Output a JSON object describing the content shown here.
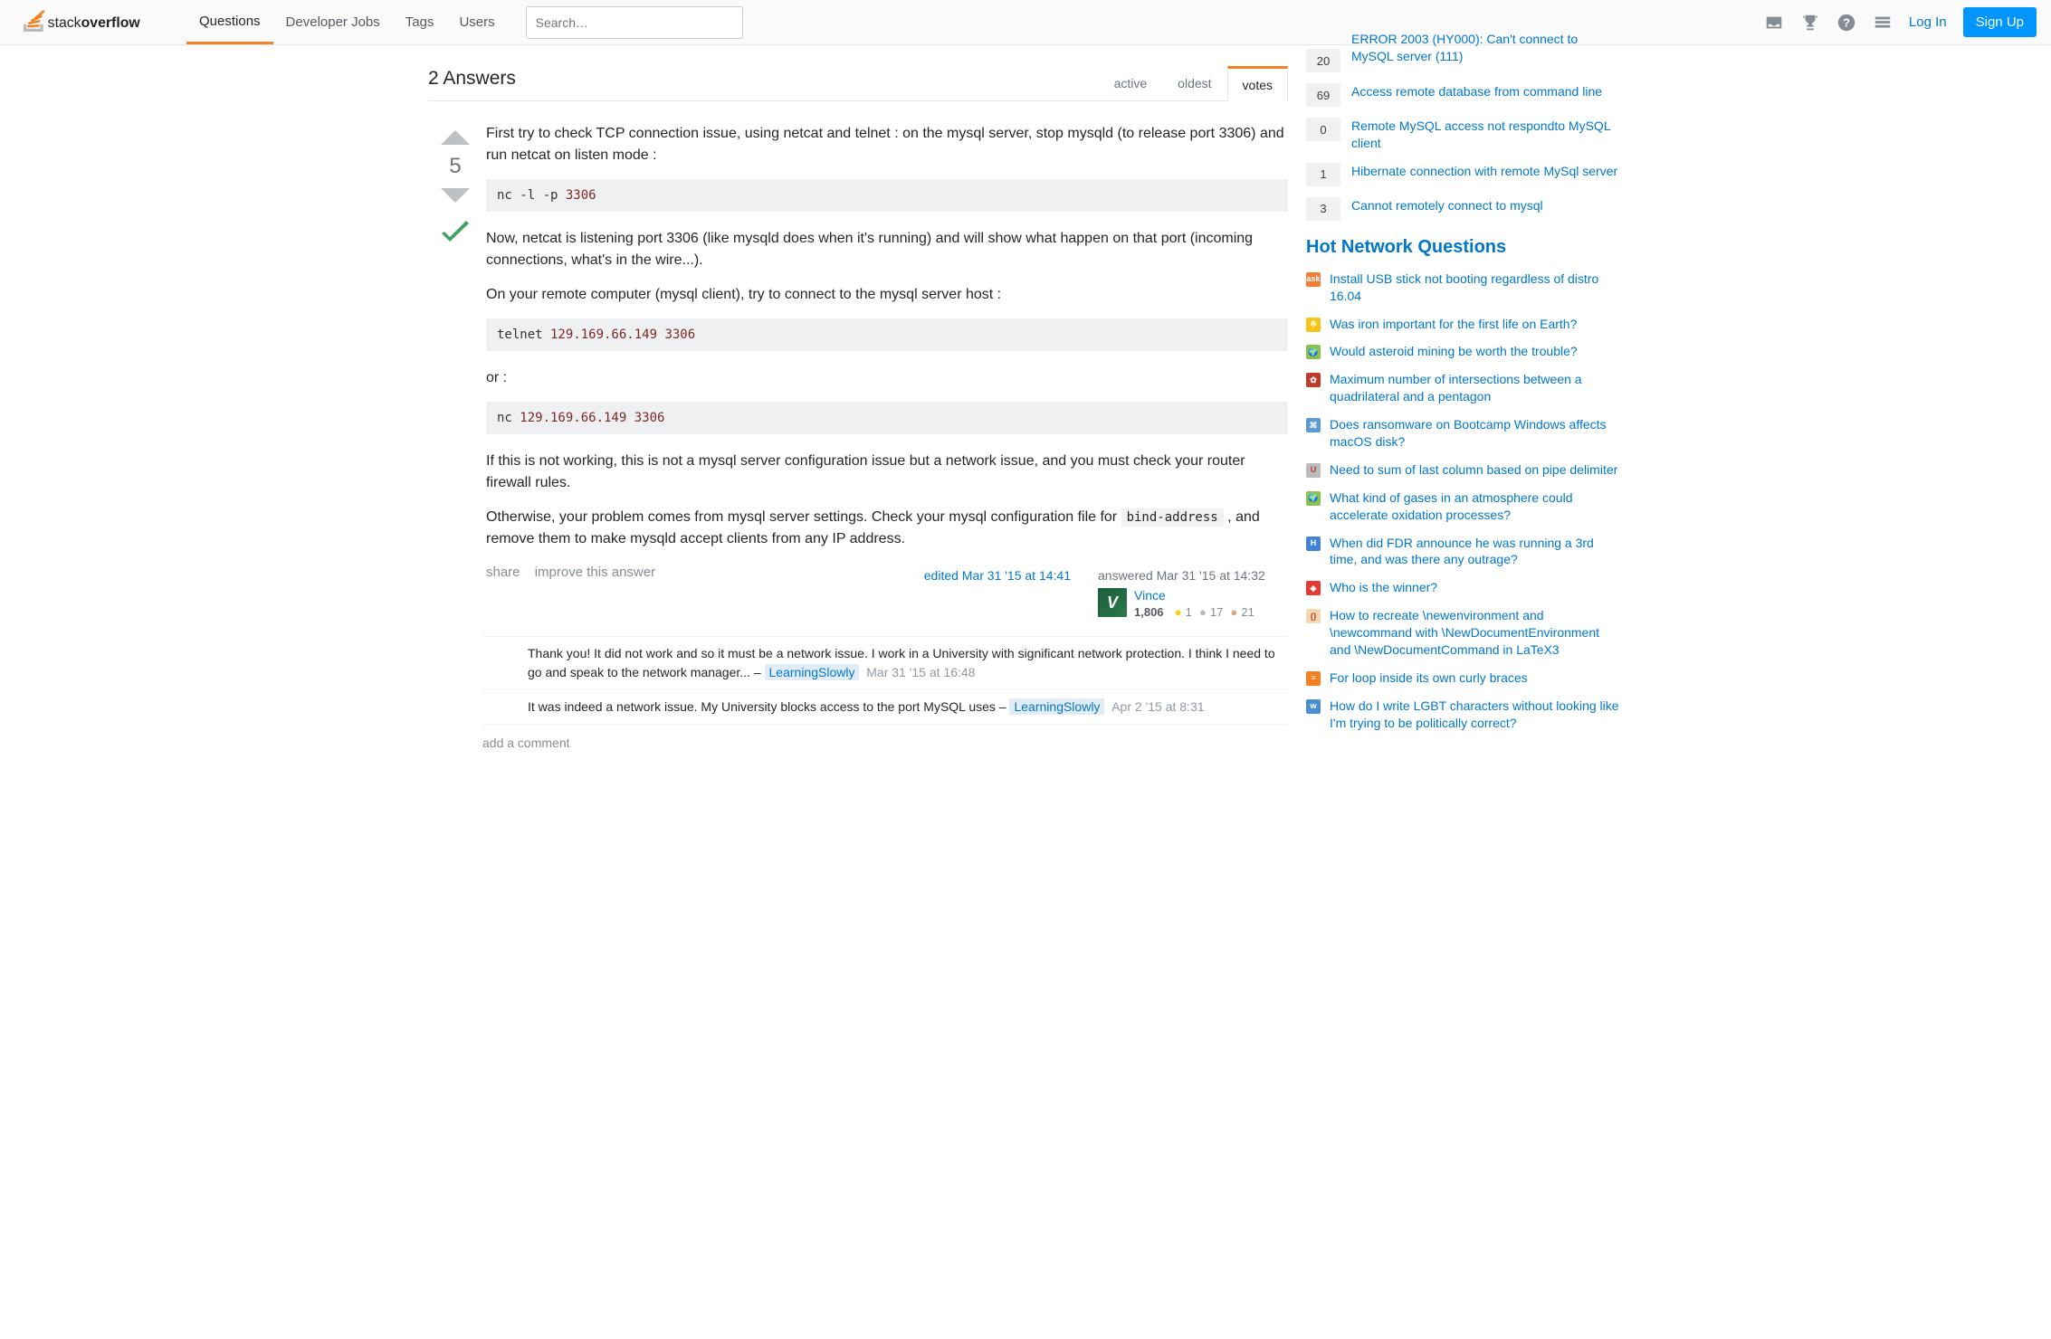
{
  "nav": {
    "questions": "Questions",
    "jobs": "Developer Jobs",
    "tags": "Tags",
    "users": "Users"
  },
  "search": {
    "placeholder": "Search…"
  },
  "auth": {
    "login": "Log In",
    "signup": "Sign Up"
  },
  "answers_header": "2 Answers",
  "tabs": {
    "active": "active",
    "oldest": "oldest",
    "votes": "votes"
  },
  "answer": {
    "votes": "5",
    "p1": "First try to check TCP connection issue, using netcat and telnet : on the mysql server, stop mysqld (to release port 3306) and run netcat on listen mode :",
    "code1": {
      "cmd": "nc",
      "args": " -l -p ",
      "num": "3306"
    },
    "p2": "Now, netcat is listening port 3306 (like mysqld does when it's running) and will show what happen on that port (incoming connections, what's in the wire...).",
    "p3": "On your remote computer (mysql client), try to connect to the mysql server host :",
    "code2": {
      "cmd": "telnet",
      "ip": " 129.169.66.149 ",
      "port": "3306"
    },
    "p4": "or :",
    "code3": {
      "cmd": "nc",
      "ip": " 129.169.66.149 ",
      "port": "3306"
    },
    "p5": "If this is not working, this is not a mysql server configuration issue but a network issue, and you must check your router firewall rules.",
    "p6a": "Otherwise, your problem comes from mysql server settings. Check your mysql configuration file for ",
    "p6code": "bind-address",
    "p6b": " , and remove them to make mysqld accept clients from any IP address.",
    "menu": {
      "share": "share",
      "improve": "improve this answer"
    },
    "edited": "edited Mar 31 '15 at 14:41",
    "answered": "answered Mar 31 '15 at 14:32",
    "user": {
      "name": "Vince",
      "rep": "1,806",
      "gold": "1",
      "silver": "17",
      "bronze": "21"
    }
  },
  "comments": [
    {
      "text": "Thank you! It did not work and so it must be a network issue. I work in a University with significant network protection. I think I need to go and speak to the network manager... – ",
      "user": "LearningSlowly",
      "date": "Mar 31 '15 at 16:48"
    },
    {
      "text": "It was indeed a network issue. My University blocks access to the port MySQL uses – ",
      "user": "LearningSlowly",
      "date": "Apr 2 '15 at 8:31"
    }
  ],
  "add_comment": "add a comment",
  "related": [
    {
      "score": "20",
      "title": "ERROR 2003 (HY000): Can't connect to MySQL server (111)"
    },
    {
      "score": "69",
      "title": "Access remote database from command line"
    },
    {
      "score": "0",
      "title": "Remote MySQL access not respondto MySQL client"
    },
    {
      "score": "1",
      "title": "Hibernate connection with remote MySql server"
    },
    {
      "score": "3",
      "title": "Cannot remotely connect to mysql"
    }
  ],
  "hnq_header": "Hot Network Questions",
  "hnq": [
    {
      "icon_bg": "#f27b35",
      "icon_text": "ask",
      "title": "Install USB stick not booting regardless of distro 16.04"
    },
    {
      "icon_bg": "#f5c518",
      "icon_text": "※",
      "title": "Was iron important for the first life on Earth?"
    },
    {
      "icon_bg": "#8bc34a",
      "icon_text": "🌍",
      "title": "Would asteroid mining be worth the trouble?"
    },
    {
      "icon_bg": "#c0392b",
      "icon_text": "✿",
      "title": "Maximum number of intersections between a quadrilateral and a pentagon"
    },
    {
      "icon_bg": "#5a9bd5",
      "icon_text": "⌘",
      "title": "Does ransomware on Bootcamp Windows affects macOS disk?"
    },
    {
      "icon_bg": "#bbb",
      "icon_text": "U",
      "title": "Need to sum of last column based on pipe delimiter"
    },
    {
      "icon_bg": "#8bc34a",
      "icon_text": "🌍",
      "title": "What kind of gases in an atmosphere could accelerate oxidation processes?"
    },
    {
      "icon_bg": "#4183d7",
      "icon_text": "H",
      "title": "When did FDR announce he was running a 3rd time, and was there any outrage?"
    },
    {
      "icon_bg": "#e53935",
      "icon_text": "◈",
      "title": "Who is the winner?"
    },
    {
      "icon_bg": "#f5d7b0",
      "icon_text": "{}",
      "title": "How to recreate \\newenvironment and \\newcommand with \\NewDocumentEnvironment and \\NewDocumentCommand in LaTeX3"
    },
    {
      "icon_bg": "#f48024",
      "icon_text": "≡",
      "title": "For loop inside its own curly braces"
    },
    {
      "icon_bg": "#4a8ed6",
      "icon_text": "w",
      "title": "How do I write LGBT characters without looking like I'm trying to be politically correct?"
    }
  ]
}
